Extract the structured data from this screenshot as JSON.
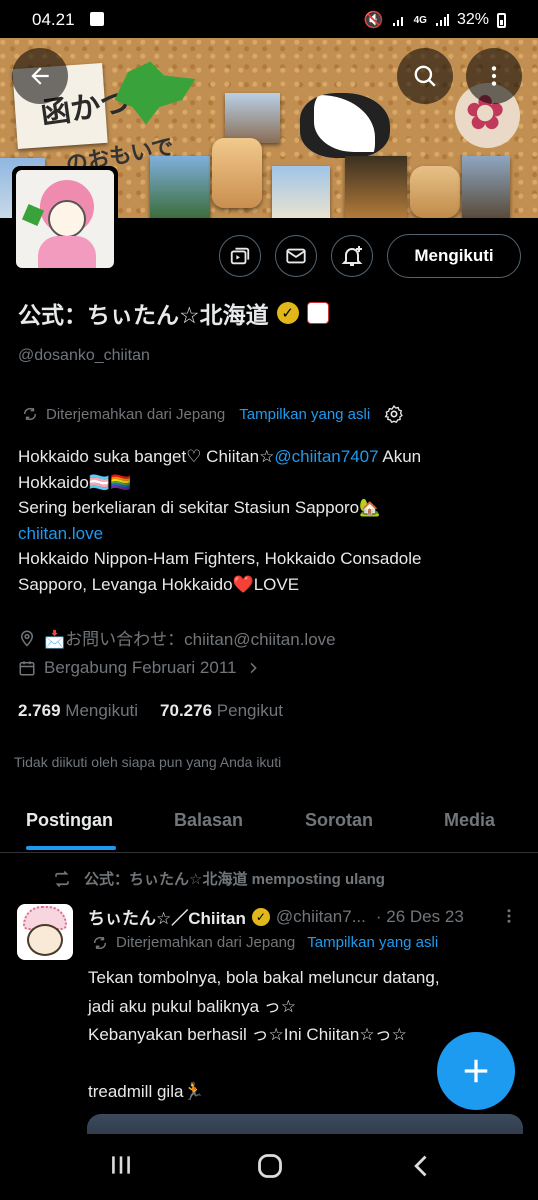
{
  "status_bar": {
    "time": "04.21",
    "network": "4G",
    "battery": "32%"
  },
  "banner": {
    "art_text_1": "函かつ",
    "art_text_2": "のおもいで"
  },
  "profile": {
    "name": "公式：ちぃたん☆北海道",
    "handle": "@dosanko_chiitan",
    "translated_from": "Diterjemahkan dari Jepang",
    "show_original": "Tampilkan yang asli",
    "bio_lines": [
      {
        "text": "Hokkaido suka banget♡ Chiitan☆",
        "mention": "@chiitan7407",
        "rest": " Akun"
      },
      "Hokkaido🏳️‍⚧️🏳️‍🌈",
      "Sering berkeliaran di sekitar Stasiun Sapporo🏡",
      "chiitan.love",
      "Hokkaido Nippon-Ham Fighters, Hokkaido Consadole",
      "Sapporo, Levanga Hokkaido❤️LOVE"
    ],
    "location": "📩お問い合わせ：chiitan@chiitan.love",
    "joined": "Bergabung Februari 2011",
    "following_count": "2.769",
    "following_label": "Mengikuti",
    "followers_count": "70.276",
    "followers_label": "Pengikut",
    "not_followed_note": "Tidak diikuti oleh siapa pun yang Anda ikuti",
    "follow_button": "Mengikuti"
  },
  "tabs": [
    {
      "label": "Postingan",
      "active": true
    },
    {
      "label": "Balasan",
      "active": false
    },
    {
      "label": "Sorotan",
      "active": false
    },
    {
      "label": "Media",
      "active": false
    }
  ],
  "post": {
    "repost_label": "公式：ちぃたん☆北海道 memposting ulang",
    "author": "ちぃたん☆／Chiitan",
    "handle": "@chiitan7...",
    "date": "· 26 Des 23",
    "translated_from": "Diterjemahkan dari Jepang",
    "show_original": "Tampilkan yang asli",
    "lines": [
      "Tekan tombolnya, bola bakal meluncur datang,",
      "jadi aku pukul baliknya っ☆",
      "Kebanyakan berhasil っ☆Ini Chiitan☆っ☆",
      "",
      "treadmill gila🏃"
    ]
  },
  "colors": {
    "accent": "#1d9bf0",
    "background": "#000000",
    "muted": "#71767b",
    "verified": "#e2b719"
  }
}
